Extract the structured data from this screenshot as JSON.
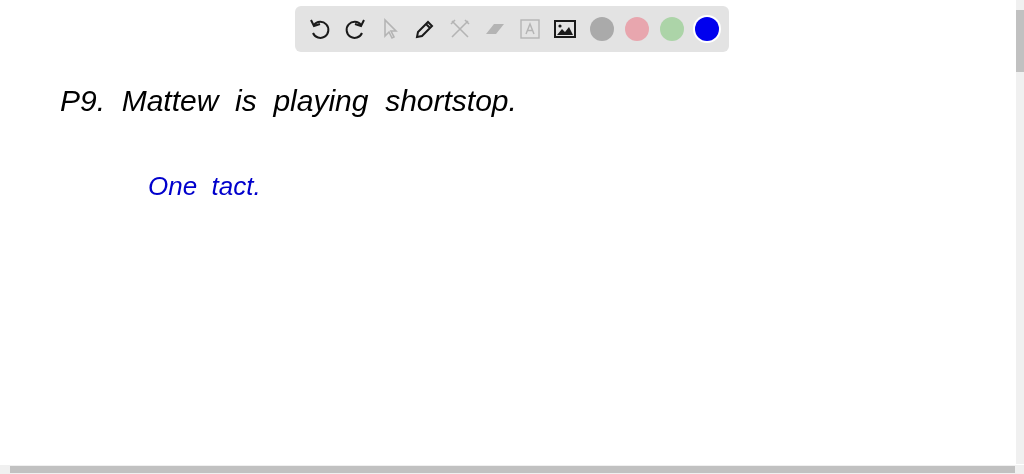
{
  "toolbar": {
    "tools": [
      {
        "kind": "undo",
        "disabled": false
      },
      {
        "kind": "redo",
        "disabled": false
      },
      {
        "kind": "select",
        "disabled": true
      },
      {
        "kind": "pen",
        "disabled": false
      },
      {
        "kind": "tools",
        "disabled": true
      },
      {
        "kind": "eraser",
        "disabled": true
      },
      {
        "kind": "text",
        "disabled": true
      },
      {
        "kind": "image",
        "disabled": false
      }
    ],
    "colors": [
      {
        "color": "#aaaaaa",
        "selected": false
      },
      {
        "color": "#e8a6ae",
        "selected": false
      },
      {
        "color": "#acd4a8",
        "selected": false
      },
      {
        "color": "#0000ee",
        "selected": true
      }
    ]
  },
  "canvas": {
    "lines": [
      {
        "text": "P9.  Mattew  is  playing  shortstop.",
        "color": "#000000"
      },
      {
        "text": "One  tact.",
        "color": "#0000cc"
      }
    ]
  }
}
